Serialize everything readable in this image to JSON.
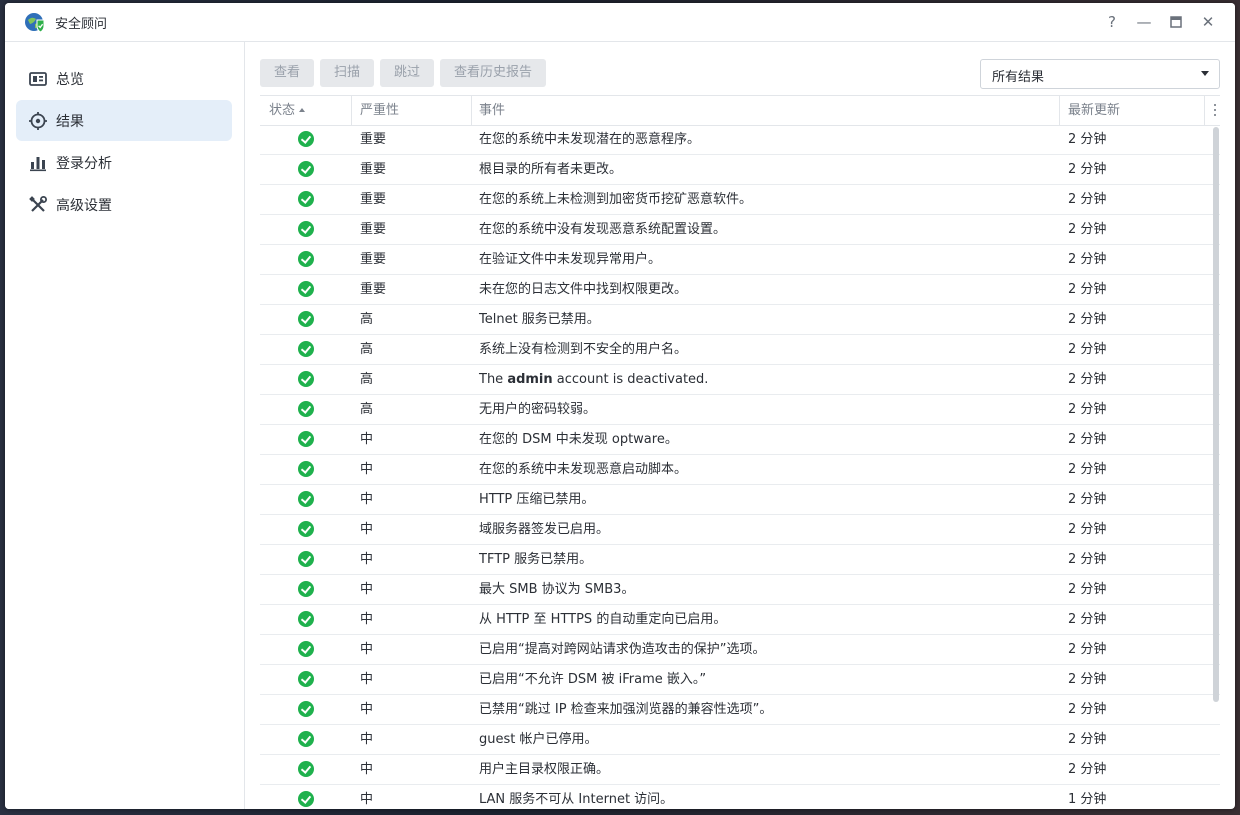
{
  "window": {
    "title": "安全顾问",
    "controls": [
      "?",
      "—",
      "▭",
      "✕"
    ]
  },
  "sidebar": {
    "items": [
      {
        "label": "总览",
        "icon": "overview-icon",
        "active": false
      },
      {
        "label": "结果",
        "icon": "results-target-icon",
        "active": true
      },
      {
        "label": "登录分析",
        "icon": "bar-chart-icon",
        "active": false
      },
      {
        "label": "高级设置",
        "icon": "tools-icon",
        "active": false
      }
    ]
  },
  "toolbar": {
    "buttons": [
      "查看",
      "扫描",
      "跳过",
      "查看历史报告"
    ],
    "filter_value": "所有结果"
  },
  "table": {
    "columns": [
      "状态",
      "严重性",
      "事件",
      "最新更新"
    ],
    "sort_column": "状态",
    "rows": [
      {
        "severity": "重要",
        "event": "在您的系统中未发现潜在的恶意程序。",
        "updated": "2 分钟"
      },
      {
        "severity": "重要",
        "event": "根目录的所有者未更改。",
        "updated": "2 分钟"
      },
      {
        "severity": "重要",
        "event": "在您的系统上未检测到加密货币挖矿恶意软件。",
        "updated": "2 分钟"
      },
      {
        "severity": "重要",
        "event": "在您的系统中没有发现恶意系统配置设置。",
        "updated": "2 分钟"
      },
      {
        "severity": "重要",
        "event": "在验证文件中未发现异常用户。",
        "updated": "2 分钟"
      },
      {
        "severity": "重要",
        "event": "未在您的日志文件中找到权限更改。",
        "updated": "2 分钟"
      },
      {
        "severity": "高",
        "event": "Telnet 服务已禁用。",
        "updated": "2 分钟"
      },
      {
        "severity": "高",
        "event": "系统上没有检测到不安全的用户名。",
        "updated": "2 分钟"
      },
      {
        "severity": "高",
        "event_pre": "The ",
        "event_bold": "admin",
        "event_post": " account is deactivated.",
        "updated": "2 分钟"
      },
      {
        "severity": "高",
        "event": "无用户的密码较弱。",
        "updated": "2 分钟"
      },
      {
        "severity": "中",
        "event": "在您的 DSM 中未发现 optware。",
        "updated": "2 分钟"
      },
      {
        "severity": "中",
        "event": "在您的系统中未发现恶意启动脚本。",
        "updated": "2 分钟"
      },
      {
        "severity": "中",
        "event": "HTTP 压缩已禁用。",
        "updated": "2 分钟"
      },
      {
        "severity": "中",
        "event": "域服务器签发已启用。",
        "updated": "2 分钟"
      },
      {
        "severity": "中",
        "event": "TFTP 服务已禁用。",
        "updated": "2 分钟"
      },
      {
        "severity": "中",
        "event": "最大 SMB 协议为 SMB3。",
        "updated": "2 分钟"
      },
      {
        "severity": "中",
        "event": "从 HTTP 至 HTTPS 的自动重定向已启用。",
        "updated": "2 分钟"
      },
      {
        "severity": "中",
        "event": "已启用“提高对跨网站请求伪造攻击的保护”选项。",
        "updated": "2 分钟"
      },
      {
        "severity": "中",
        "event": "已启用“不允许 DSM 被 iFrame 嵌入。”",
        "updated": "2 分钟"
      },
      {
        "severity": "中",
        "event": "已禁用“跳过 IP 检查来加强浏览器的兼容性选项”。",
        "updated": "2 分钟"
      },
      {
        "severity": "中",
        "event": "guest 帐户已停用。",
        "updated": "2 分钟"
      },
      {
        "severity": "中",
        "event": "用户主目录权限正确。",
        "updated": "2 分钟"
      },
      {
        "severity": "中",
        "event": "LAN 服务不可从 Internet 访问。",
        "updated": "1 分钟"
      }
    ]
  },
  "colors": {
    "accent": "#2f7bd6",
    "status_ok": "#1fb14d",
    "active_nav_bg": "#e4eef9",
    "disabled_button_bg": "#e6e8eb"
  }
}
